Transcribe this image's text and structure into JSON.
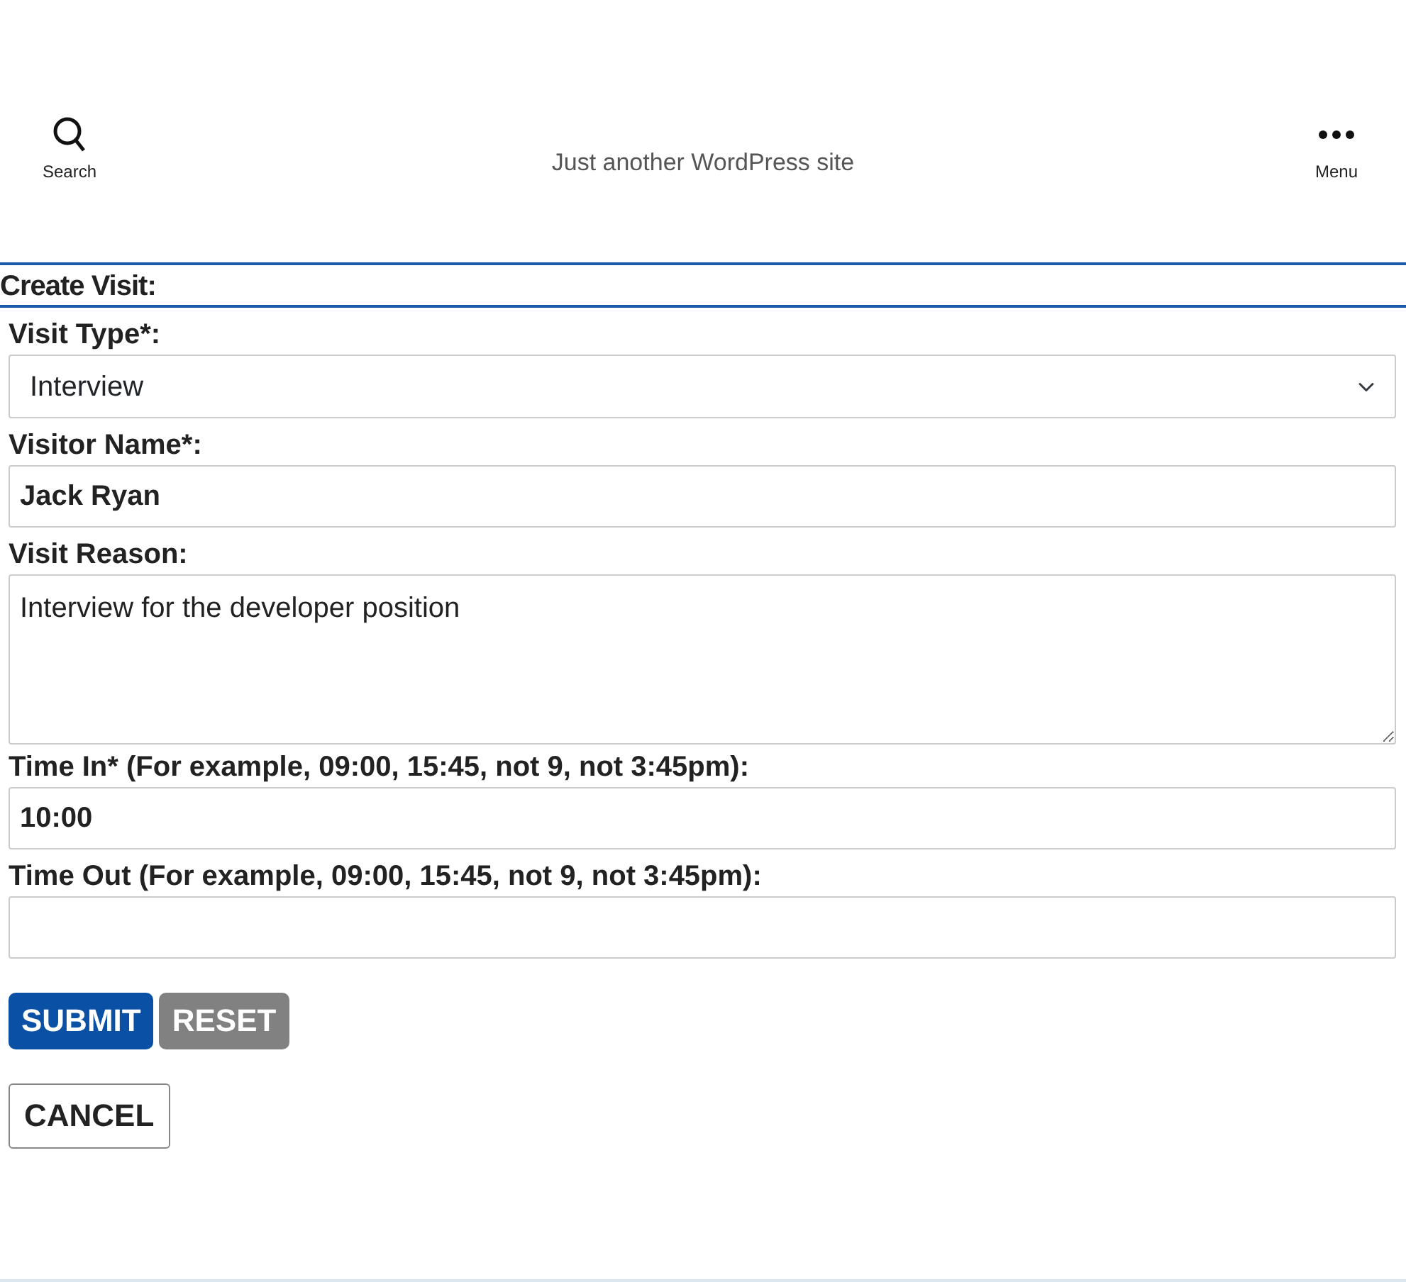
{
  "header": {
    "search_label": "Search",
    "tagline": "Just another WordPress site",
    "menu_label": "Menu"
  },
  "form": {
    "title": "Create Visit:",
    "fields": [
      {
        "kind": "select",
        "label": "Visit Type*:",
        "value": "Interview"
      },
      {
        "kind": "input",
        "label": "Visitor Name*:",
        "value": "Jack Ryan"
      },
      {
        "kind": "textarea",
        "label": "Visit Reason:",
        "value": "Interview for the developer position"
      },
      {
        "kind": "input",
        "label": "Time In* (For example, 09:00, 15:45, not 9, not 3:45pm):",
        "value": "10:00"
      },
      {
        "kind": "input",
        "label": "Time Out (For example, 09:00, 15:45, not 9, not 3:45pm):"
      }
    ],
    "buttons": [
      {
        "kind": "primary",
        "label": "SUBMIT"
      },
      {
        "kind": "secondary",
        "label": "RESET"
      }
    ],
    "cancel": {
      "kind": "outline",
      "label": "CANCEL"
    }
  }
}
